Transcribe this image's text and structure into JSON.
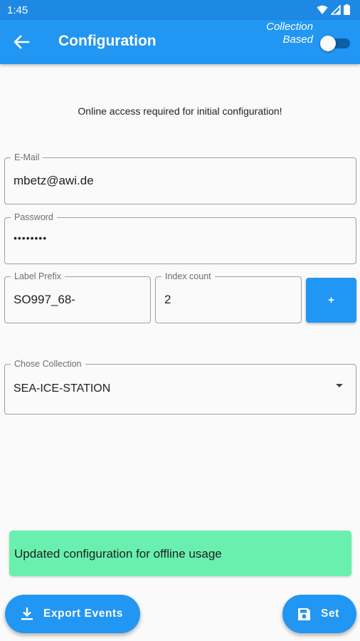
{
  "status_bar": {
    "time": "1:45"
  },
  "app_bar": {
    "title": "Configuration",
    "toggle_label_line1": "Collection",
    "toggle_label_line2": "Based",
    "toggle_on": false
  },
  "notice": "Online access required for initial configuration!",
  "fields": {
    "email": {
      "label": "E-Mail",
      "value": "mbetz@awi.de"
    },
    "password": {
      "label": "Password",
      "value": "••••••••"
    },
    "label_prefix": {
      "label": "Label Prefix",
      "value": "SO997_68-"
    },
    "index_count": {
      "label": "Index count",
      "value": "2"
    },
    "collection": {
      "label": "Chose Collection",
      "value": "SEA-ICE-STATION"
    }
  },
  "plus_button": {
    "label": "+"
  },
  "snackbar": {
    "text": "Updated configuration for offline usage",
    "color": "#69f0ae"
  },
  "actions": {
    "export_label": "Export Events",
    "set_label": "Set"
  },
  "colors": {
    "primary": "#2196f3",
    "status_bar": "#1e88e5"
  }
}
